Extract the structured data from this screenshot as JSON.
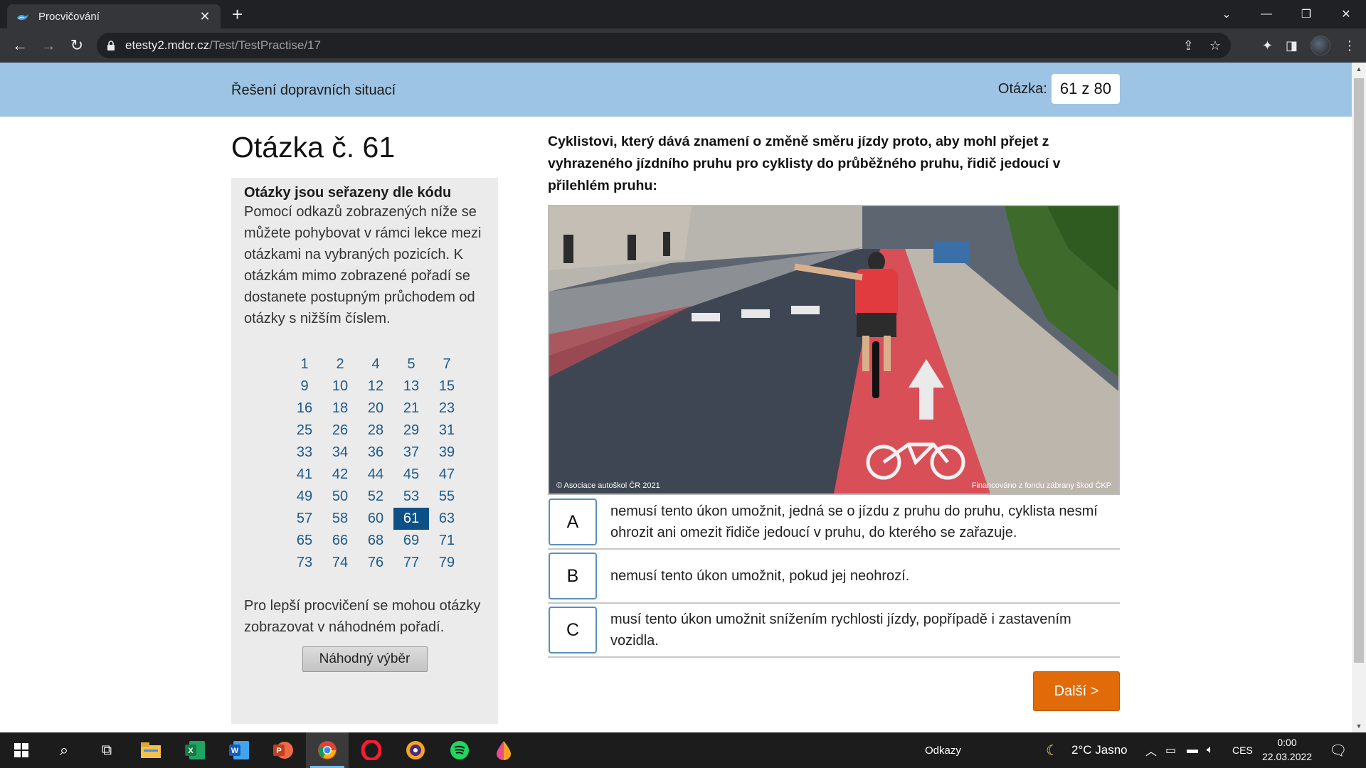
{
  "browser": {
    "tab_title": "Procvičování",
    "url_host": "etesty2.mdcr.cz",
    "url_path": "/Test/TestPractise/17"
  },
  "header": {
    "section_title": "Řešení dopravních situací",
    "question_label": "Otázka:",
    "question_counter": "61 z 80"
  },
  "question": {
    "heading": "Otázka č. 61",
    "text": "Cyklistovi, který dává znamení o změně směru jízdy proto, aby mohl přejet z vyhrazeného jízdního pruhu pro cyklisty do průběžného pruhu, řidič jedoucí v přilehlém pruhu:",
    "image_caption_left": "© Asociace autoškol ČR 2021",
    "image_caption_right": "Financováno z fondu zábrany škod ČKP",
    "answers": [
      {
        "letter": "A",
        "text": "nemusí tento úkon umožnit, jedná se o jízdu z pruhu do pruhu, cyklista nesmí ohrozit ani omezit řidiče jedoucí v pruhu, do kterého se zařazuje."
      },
      {
        "letter": "B",
        "text": "nemusí tento úkon umožnit, pokud jej neohrozí."
      },
      {
        "letter": "C",
        "text": "musí tento úkon umožnit snížením rychlosti jízdy, popřípadě i zastavením vozidla."
      }
    ],
    "next_label": "Další >"
  },
  "sidebar": {
    "title": "Otázky jsou seřazeny dle kódu",
    "text": "Pomocí odkazů zobrazených níže se můžete pohybovat v rámci lekce mezi otázkami na vybraných pozicích. K otázkám mimo zobrazené pořadí se dostanete postupným průchodem od otázky s nižším číslem.",
    "numbers": [
      "1",
      "2",
      "4",
      "5",
      "7",
      "9",
      "10",
      "12",
      "13",
      "15",
      "16",
      "18",
      "20",
      "21",
      "23",
      "25",
      "26",
      "28",
      "29",
      "31",
      "33",
      "34",
      "36",
      "37",
      "39",
      "41",
      "42",
      "44",
      "45",
      "47",
      "49",
      "50",
      "52",
      "53",
      "55",
      "57",
      "58",
      "60",
      "61",
      "63",
      "65",
      "66",
      "68",
      "69",
      "71",
      "73",
      "74",
      "76",
      "77",
      "79"
    ],
    "current": "61",
    "random_text": "Pro lepší procvičení se mohou otázky zobrazovat v náhodném pořadí.",
    "random_button": "Náhodný výběr"
  },
  "taskbar": {
    "links_label": "Odkazy",
    "weather": "2°C  Jasno",
    "language": "CES",
    "time": "0:00",
    "date": "22.03.2022"
  },
  "colors": {
    "header_bg": "#9dc4e4",
    "current_question_bg": "#0d5088",
    "next_button": "#e06b08",
    "answer_border": "#5b8fc0"
  }
}
